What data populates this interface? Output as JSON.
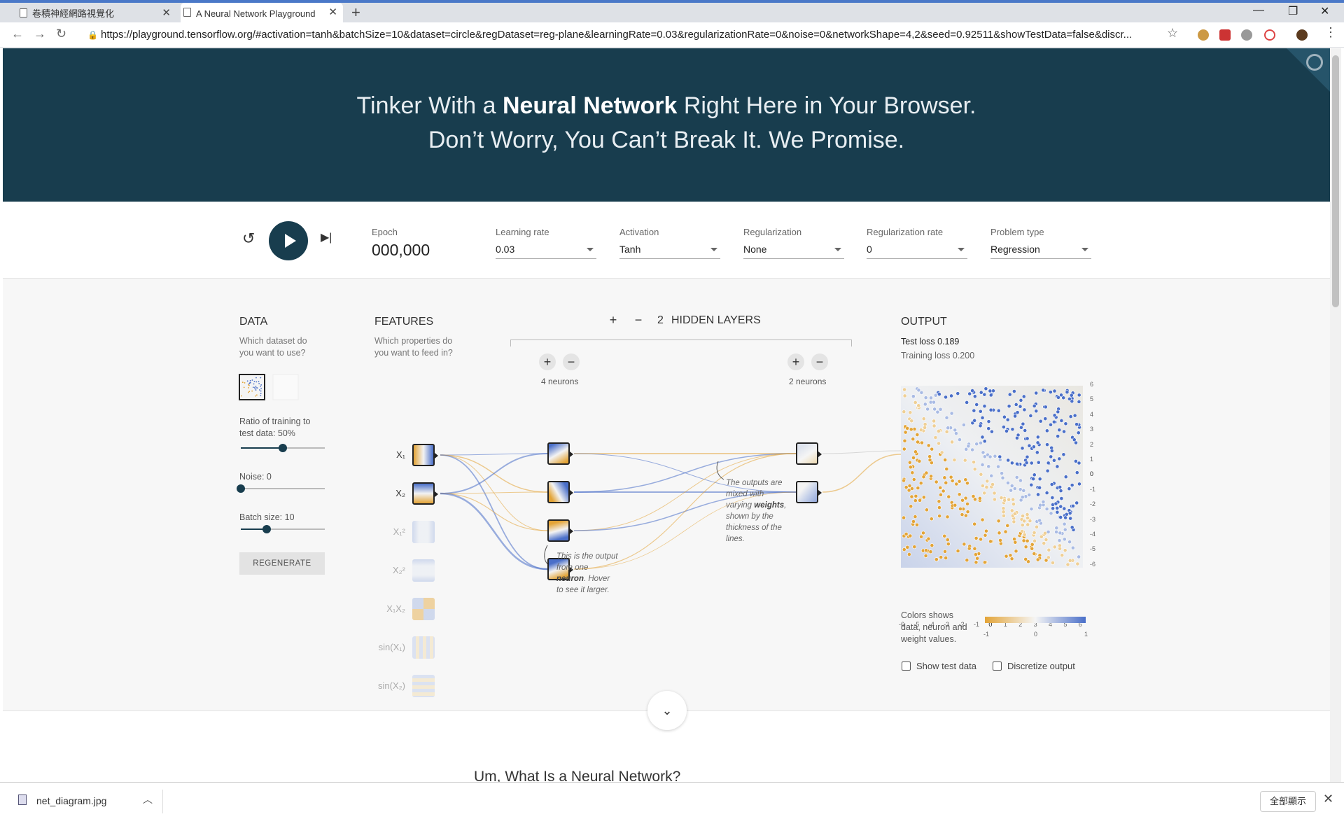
{
  "browser": {
    "tabs": [
      {
        "title": "卷積神經網路視覺化",
        "active": false
      },
      {
        "title": "A Neural Network Playground",
        "active": true
      }
    ],
    "url": "https://playground.tensorflow.org/#activation=tanh&batchSize=10&dataset=circle&regDataset=reg-plane&learningRate=0.03&regularizationRate=0&noise=0&networkShape=4,2&seed=0.92511&showTestData=false&discr..."
  },
  "hero": {
    "line1_pre": "Tinker With a ",
    "line1_bold": "Neural Network",
    "line1_post": " Right Here in Your Browser.",
    "line2": "Don’t Worry, You Can’t Break It. We Promise."
  },
  "controls": {
    "epoch_label": "Epoch",
    "epoch_value": "000,000",
    "learning_rate_label": "Learning rate",
    "learning_rate_value": "0.03",
    "activation_label": "Activation",
    "activation_value": "Tanh",
    "regularization_label": "Regularization",
    "regularization_value": "None",
    "reg_rate_label": "Regularization rate",
    "reg_rate_value": "0",
    "problem_type_label": "Problem type",
    "problem_type_value": "Regression"
  },
  "data_panel": {
    "title": "DATA",
    "subtitle_1": "Which dataset do",
    "subtitle_2": "you want to use?",
    "ratio_label_1": "Ratio of training to",
    "ratio_label_2": "test data:  50%",
    "ratio_value": 0.5,
    "noise_label": "Noise:  0",
    "noise_value": 0,
    "batch_label": "Batch size:  10",
    "batch_value": 0.31,
    "regenerate": "REGENERATE"
  },
  "features_panel": {
    "title": "FEATURES",
    "subtitle_1": "Which properties do",
    "subtitle_2": "you want to feed in?",
    "features": [
      {
        "label": "X₁",
        "active": true
      },
      {
        "label": "X₂",
        "active": true
      },
      {
        "label": "X₁²",
        "active": false
      },
      {
        "label": "X₂²",
        "active": false
      },
      {
        "label": "X₁X₂",
        "active": false
      },
      {
        "label": "sin(X₁)",
        "active": false
      },
      {
        "label": "sin(X₂)",
        "active": false
      }
    ]
  },
  "hidden_layers": {
    "count": "2",
    "label": "HIDDEN LAYERS",
    "layer1_neurons": "4 neurons",
    "layer2_neurons": "2 neurons",
    "annotation1_l1": "This is the output",
    "annotation1_l2": "from one",
    "annotation1_bold": "neuron",
    "annotation1_l3": ". Hover",
    "annotation1_l4": "to see it larger.",
    "annotation2_l1": "The outputs are",
    "annotation2_l2": "mixed with",
    "annotation2_l3a": "varying ",
    "annotation2_bold": "weights",
    "annotation2_l3b": ",",
    "annotation2_l4": "shown by the",
    "annotation2_l5": "thickness of the",
    "annotation2_l6": "lines."
  },
  "output_panel": {
    "title": "OUTPUT",
    "test_loss": "Test loss 0.189",
    "training_loss": "Training loss 0.200",
    "x_ticks": [
      "-6",
      "-5",
      "-4",
      "-3",
      "-2",
      "-1",
      "0",
      "1",
      "2",
      "3",
      "4",
      "5",
      "6"
    ],
    "y_ticks": [
      "6",
      "5",
      "4",
      "3",
      "2",
      "1",
      "0",
      "-1",
      "-2",
      "-3",
      "-4",
      "-5",
      "-6"
    ],
    "legend_1": "Colors shows",
    "legend_2": "data, neuron and",
    "legend_3": "weight values.",
    "legend_min": "-1",
    "legend_mid": "0",
    "legend_max": "1",
    "show_test_data": "Show test data",
    "discretize_output": "Discretize output"
  },
  "colors": {
    "negative": "#e3a437",
    "positive": "#4a6fc9",
    "neutral": "#f5f5f5",
    "hero_bg": "#183d4e"
  },
  "below": {
    "heading": "Um, What Is a Neural Network?"
  },
  "downloads": {
    "file": "net_diagram.jpg",
    "show_all": "全部顯示"
  }
}
